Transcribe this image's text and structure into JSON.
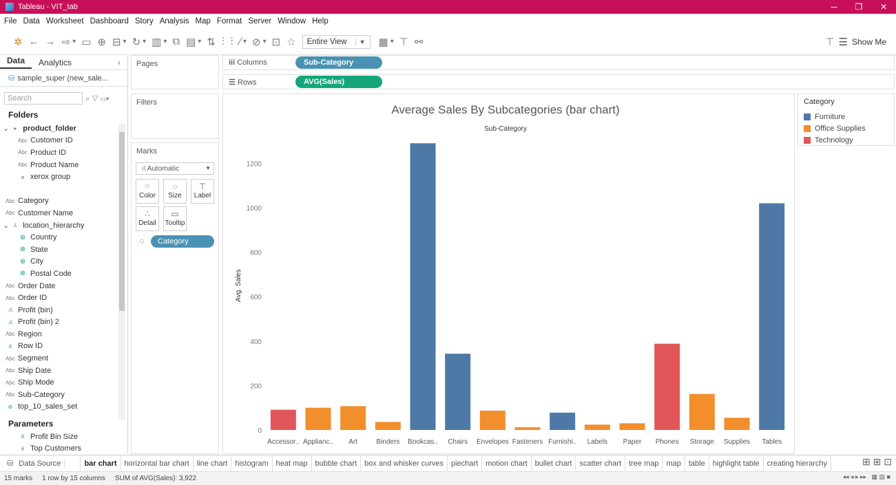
{
  "window": {
    "title": "Tableau - VIT_tab",
    "min": "─",
    "max": "❐",
    "close": "✕"
  },
  "menu": [
    "File",
    "Data",
    "Worksheet",
    "Dashboard",
    "Story",
    "Analysis",
    "Map",
    "Format",
    "Server",
    "Window",
    "Help"
  ],
  "toolbar": {
    "view_select": "Entire View",
    "show_me": "Show Me"
  },
  "data_pane": {
    "tabs": [
      "Data",
      "Analytics"
    ],
    "datasource": "sample_super (new_sale...",
    "search_placeholder": "Search",
    "folders_heading": "Folders",
    "parameters_heading": "Parameters",
    "fields": [
      {
        "name": "product_folder",
        "kind": "folder",
        "indent": 0
      },
      {
        "name": "Customer ID",
        "kind": "Abc",
        "indent": 1
      },
      {
        "name": "Product ID",
        "kind": "Abc",
        "indent": 1
      },
      {
        "name": "Product Name",
        "kind": "Abc",
        "indent": 1
      },
      {
        "name": "xerox group",
        "kind": "clip",
        "indent": 1
      },
      {
        "name": "",
        "kind": "blank",
        "indent": 0
      },
      {
        "name": "Category",
        "kind": "Abc",
        "indent": 0
      },
      {
        "name": "Customer Name",
        "kind": "Abc",
        "indent": 0
      },
      {
        "name": "location_hierarchy",
        "kind": "hier",
        "indent": 0
      },
      {
        "name": "Country",
        "kind": "geo",
        "indent": 1
      },
      {
        "name": "State",
        "kind": "geo",
        "indent": 1
      },
      {
        "name": "City",
        "kind": "geo",
        "indent": 1
      },
      {
        "name": "Postal Code",
        "kind": "geo",
        "indent": 1
      },
      {
        "name": "Order Date",
        "kind": "Abc",
        "indent": 0
      },
      {
        "name": "Order ID",
        "kind": "Abc",
        "indent": 0
      },
      {
        "name": "Profit (bin)",
        "kind": "bin",
        "indent": 0
      },
      {
        "name": "Profit (bin) 2",
        "kind": "bin",
        "indent": 0
      },
      {
        "name": "Region",
        "kind": "Abc",
        "indent": 0
      },
      {
        "name": "Row ID",
        "kind": "#",
        "indent": 0
      },
      {
        "name": "Segment",
        "kind": "Abc",
        "indent": 0
      },
      {
        "name": "Ship Date",
        "kind": "Abc",
        "indent": 0
      },
      {
        "name": "Ship Mode",
        "kind": "Abc",
        "indent": 0
      },
      {
        "name": "Sub-Category",
        "kind": "Abc",
        "indent": 0
      },
      {
        "name": "top_10_sales_set",
        "kind": "set",
        "indent": 0
      }
    ],
    "parameters": [
      "Profit Bin Size",
      "Top Customers"
    ]
  },
  "cards": {
    "pages": "Pages",
    "filters": "Filters",
    "marks": "Marks",
    "mark_type": "Automatic",
    "mark_buttons": [
      "Color",
      "Size",
      "Label",
      "Detail",
      "Tooltip"
    ],
    "category_pill": "Category"
  },
  "shelves": {
    "columns_label": "Columns",
    "columns_pill": "Sub-Category",
    "rows_label": "Rows",
    "rows_pill": "AVG(Sales)"
  },
  "legend": {
    "title": "Category",
    "items": [
      {
        "label": "Furniture",
        "color": "#4e79a7"
      },
      {
        "label": "Office Supplies",
        "color": "#f28e2b"
      },
      {
        "label": "Technology",
        "color": "#e15759"
      }
    ]
  },
  "chart_data": {
    "type": "bar",
    "title": "Average Sales By Subcategories (bar chart)",
    "xlabel": "Sub-Category",
    "ylabel": "Avg. Sales",
    "ylim": [
      0,
      1300
    ],
    "yticks": [
      0,
      200,
      400,
      600,
      800,
      1000,
      1200
    ],
    "categories": [
      "Accessor..",
      "Applianc..",
      "Art",
      "Binders",
      "Bookcas..",
      "Chairs",
      "Envelopes",
      "Fasteners",
      "Furnishi..",
      "Labels",
      "Paper",
      "Phones",
      "Storage",
      "Supplies",
      "Tables"
    ],
    "values": [
      91,
      100,
      107,
      36,
      1290,
      343,
      87,
      12,
      78,
      24,
      30,
      388,
      162,
      55,
      1020
    ],
    "colors": [
      "#e15759",
      "#f28e2b",
      "#f28e2b",
      "#f28e2b",
      "#4e79a7",
      "#4e79a7",
      "#f28e2b",
      "#f28e2b",
      "#4e79a7",
      "#f28e2b",
      "#f28e2b",
      "#e15759",
      "#f28e2b",
      "#f28e2b",
      "#4e79a7"
    ],
    "grid": false,
    "legend": "right"
  },
  "sheets": {
    "data_source_tab": "Data Source",
    "tabs": [
      "bar chart",
      "horizontal bar chart",
      "line chart",
      "histogram",
      "heat map",
      "bubble chart",
      "box and whisker curves",
      "piechart",
      "motion chart",
      "bullet chart",
      "scatter chart",
      "tree map",
      "map",
      "table",
      "highlight table",
      "creating hierarchy"
    ],
    "active": "bar chart"
  },
  "status": {
    "marks": "15 marks",
    "dims": "1 row by 15 columns",
    "sum": "SUM of AVG(Sales): 3,922"
  }
}
